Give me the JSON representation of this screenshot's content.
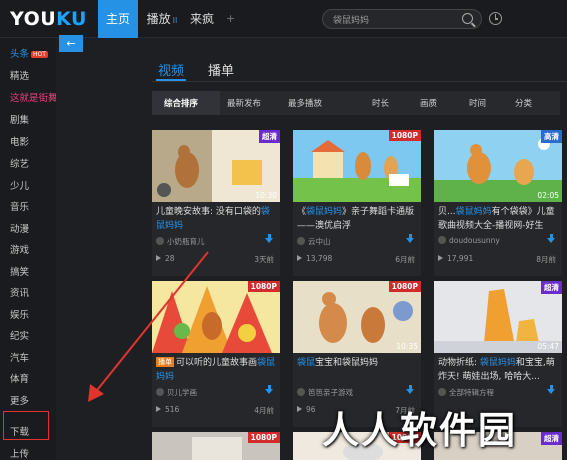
{
  "app": {
    "logo_you": "YOU",
    "logo_ku": "KU"
  },
  "topnav": [
    {
      "label": "主页",
      "active": true
    },
    {
      "label": "播放",
      "active": false,
      "suffix": "II"
    },
    {
      "label": "来疯",
      "active": false
    }
  ],
  "topnav_plus": "+",
  "search": {
    "value": "袋鼠妈妈",
    "placeholder": "袋鼠妈妈"
  },
  "sidebar": {
    "items": [
      {
        "label": "头条",
        "badge": "HOT"
      },
      {
        "label": "精选"
      },
      {
        "label": "这就是街舞"
      },
      {
        "label": "剧集"
      },
      {
        "label": "电影"
      },
      {
        "label": "综艺"
      },
      {
        "label": "少儿"
      },
      {
        "label": "音乐"
      },
      {
        "label": "动漫"
      },
      {
        "label": "游戏"
      },
      {
        "label": "搞笑"
      },
      {
        "label": "资讯"
      },
      {
        "label": "娱乐"
      },
      {
        "label": "纪实"
      },
      {
        "label": "汽车"
      },
      {
        "label": "体育"
      },
      {
        "label": "更多"
      },
      {
        "label": "下载"
      },
      {
        "label": "上传"
      }
    ]
  },
  "back_button": "←",
  "content_tabs": [
    {
      "label": "视频",
      "active": true
    },
    {
      "label": "播单",
      "active": false
    }
  ],
  "filters": [
    "综合排序",
    "最新发布",
    "最多播放",
    "时长",
    "画质",
    "时间",
    "分类"
  ],
  "videos": [
    {
      "badge": "超清",
      "duration": "10:30",
      "title_pre": "儿童晚安故事: 没有口袋的",
      "title_hl": "袋鼠妈妈",
      "title_post": "",
      "tag": "",
      "uploader": "小奶瓶育儿",
      "plays": "28",
      "when": "3天前"
    },
    {
      "badge": "1080P",
      "duration": "",
      "title_pre": "《",
      "title_hl": "袋鼠妈妈",
      "title_post": "》亲子舞蹈卡通版——澳优启浮",
      "tag": "",
      "uploader": "云中山",
      "plays": "13,798",
      "when": "6月前"
    },
    {
      "badge": "高清",
      "duration": "02:05",
      "title_pre": "贝...",
      "title_hl": "袋鼠妈妈",
      "title_post": "有个袋袋》儿童歌曲视频大全-播视网-好生",
      "tag": "",
      "uploader": "doudousunny",
      "plays": "17,991",
      "when": "8月前"
    },
    {
      "badge": "1080P",
      "duration": "",
      "title_pre": "可以听的儿童故事画",
      "title_hl": "袋鼠妈妈",
      "title_post": "",
      "tag": "播单",
      "uploader": "贝儿学画",
      "plays": "516",
      "when": "4月前"
    },
    {
      "badge": "1080P",
      "duration": "10:35",
      "title_pre": "",
      "title_hl": "袋鼠",
      "title_post": "宝宝和袋鼠妈妈",
      "tag": "",
      "uploader": "笆笆亲子游戏",
      "plays": "96",
      "when": "7月前"
    },
    {
      "badge": "超清",
      "duration": "05:47",
      "title_pre": "动物折纸: ",
      "title_hl": "袋鼠妈妈",
      "title_post": "和宝宝,萌炸天! 萌娃出场, 哈哈大...",
      "tag": "",
      "uploader": "全部特辑方程",
      "plays": "",
      "when": ""
    },
    {
      "badge": "1080P",
      "duration": "",
      "title_pre": "",
      "title_hl": "",
      "title_post": "",
      "tag": "",
      "uploader": "",
      "plays": "",
      "when": ""
    },
    {
      "badge": "1080P",
      "duration": "",
      "title_pre": "",
      "title_hl": "",
      "title_post": "",
      "tag": "",
      "uploader": "",
      "plays": "",
      "when": ""
    },
    {
      "badge": "超清",
      "duration": "",
      "title_pre": "",
      "title_hl": "",
      "title_post": "",
      "tag": "",
      "uploader": "",
      "plays": "",
      "when": ""
    }
  ],
  "watermark": "人人软件园",
  "colors": {
    "accent": "#2592e6",
    "highlight_red": "#e0342c"
  }
}
